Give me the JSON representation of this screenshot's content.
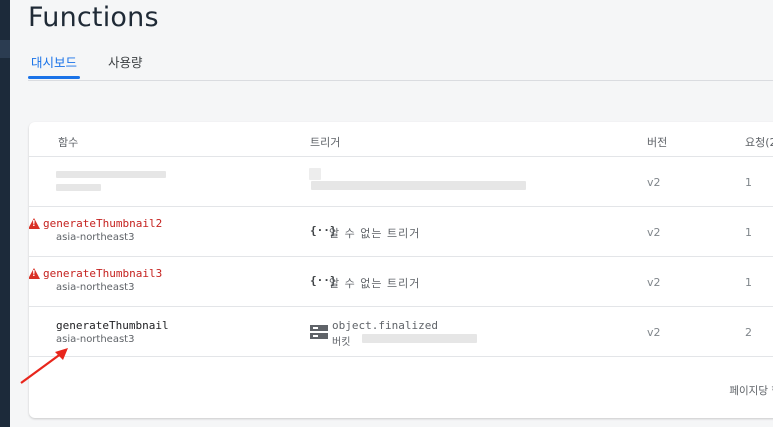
{
  "page": {
    "title": "Functions"
  },
  "tabs": [
    {
      "label": "대시보드"
    },
    {
      "label": "사용량"
    }
  ],
  "table": {
    "headers": {
      "function": "함수",
      "trigger": "트리거",
      "version": "버전",
      "requests": "요청(2"
    },
    "rows": [
      {
        "status": "ok",
        "name": "",
        "region": "",
        "trigger_icon": "",
        "trigger": "",
        "version": "v2",
        "requests": "1"
      },
      {
        "status": "error",
        "name": "generateThumbnail2",
        "region": "asia-northeast3",
        "trigger_icon": "unknown-trigger-icon",
        "trigger": "알 수 없는 트리거",
        "version": "v2",
        "requests": "1"
      },
      {
        "status": "error",
        "name": "generateThumbnail3",
        "region": "asia-northeast3",
        "trigger_icon": "unknown-trigger-icon",
        "trigger": "알 수 없는 트리거",
        "version": "v2",
        "requests": "1"
      },
      {
        "status": "ok",
        "name": "generateThumbnail",
        "region": "asia-northeast3",
        "trigger_icon": "storage-bucket-icon",
        "trigger": "object.finalized",
        "trigger_sub": "버킷",
        "version": "v2",
        "requests": "2"
      }
    ]
  },
  "footer": {
    "rows_per_page_label": "페이지당 항"
  },
  "colors": {
    "accent": "#1a73e8",
    "error": "#c5221f",
    "annotation_arrow": "#e8261c"
  }
}
